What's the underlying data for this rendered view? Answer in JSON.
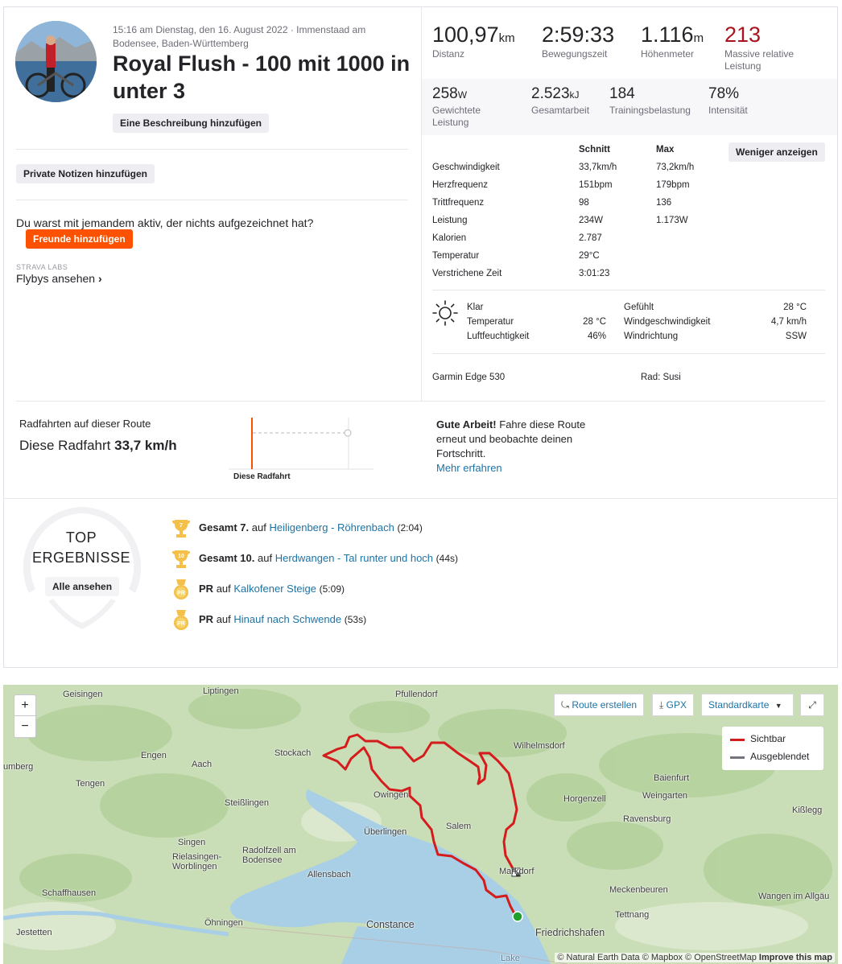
{
  "header": {
    "meta": "15:16 am Dienstag, den 16. August 2022 · Immenstaad am Bodensee, Baden-Württemberg",
    "title": "Royal Flush - 100 mit 1000 in unter 3",
    "add_description": "Eine Beschreibung hinzufügen"
  },
  "left": {
    "private_notes": "Private Notizen hinzufügen",
    "with_someone": "Du warst mit jemandem aktiv, der nichts aufgezeichnet hat?",
    "add_friends": "Freunde hinzufügen",
    "labs": "STRAVA LABS",
    "flybys": "Flybys ansehen",
    "flybys_arrow": "›"
  },
  "stats": {
    "distance": {
      "value": "100,97",
      "unit": "km",
      "label": "Distanz"
    },
    "moving_time": {
      "value": "2:59:33",
      "label": "Bewegungszeit"
    },
    "elevation": {
      "value": "1.116",
      "unit": "m",
      "label": "Höhenmeter"
    },
    "relative_effort": {
      "value": "213",
      "label": "Massive relative Leistung"
    },
    "weighted_power": {
      "value": "258",
      "unit": "W",
      "label": "Gewichtete Leistung"
    },
    "total_work": {
      "value": "2.523",
      "unit": "kJ",
      "label": "Gesamtarbeit"
    },
    "training_load": {
      "value": "184",
      "label": "Trainingsbelastung"
    },
    "intensity": {
      "value": "78%",
      "label": "Intensität"
    },
    "relative_effort_color": "#a8131f"
  },
  "detail": {
    "col_avg": "Schnitt",
    "col_max": "Max",
    "show_less": "Weniger anzeigen",
    "rows": [
      {
        "label": "Geschwindigkeit",
        "avg": "33,7km/h",
        "max": "73,2km/h"
      },
      {
        "label": "Herzfrequenz",
        "avg": "151bpm",
        "max": "179bpm"
      },
      {
        "label": "Trittfrequenz",
        "avg": "98",
        "max": "136"
      },
      {
        "label": "Leistung",
        "avg": "234W",
        "max": "1.173W"
      },
      {
        "label": "Kalorien",
        "avg": "2.787",
        "max": ""
      },
      {
        "label": "Temperatur",
        "avg": "29°C",
        "max": ""
      },
      {
        "label": "Verstrichene Zeit",
        "avg": "3:01:23",
        "max": ""
      }
    ]
  },
  "weather": {
    "icon": "sun-icon",
    "condition": "Klar",
    "temp_label": "Temperatur",
    "temp": "28 °C",
    "humidity_label": "Luftfeuchtigkeit",
    "humidity": "46%",
    "feels_label": "Gefühlt",
    "feels": "28 °C",
    "wind_speed_label": "Windgeschwindigkeit",
    "wind_speed": "4,7 km/h",
    "wind_dir_label": "Windrichtung",
    "wind_dir": "SSW"
  },
  "device": {
    "name": "Garmin Edge 530",
    "bike": "Rad: Susi"
  },
  "route": {
    "label": "Radfahrten auf dieser Route",
    "this_ride": "Diese Radfahrt",
    "speed": "33,7 km/h",
    "chart_label": "Diese Radfahrt",
    "msg_bold": "Gute Arbeit!",
    "msg": "Fahre diese Route erneut und beobachte deinen Fortschritt.",
    "more": "Mehr erfahren"
  },
  "top": {
    "title_1": "TOP",
    "title_2": "ERGEBNISSE",
    "see_all": "Alle ansehen",
    "items": [
      {
        "medal": "7",
        "rank": "Gesamt 7.",
        "prep": "auf",
        "segment": "Heiligenberg - Röhrenbach",
        "time": "(2:04)"
      },
      {
        "medal": "10",
        "rank": "Gesamt 10.",
        "prep": "auf",
        "segment": "Herdwangen - Tal runter und hoch",
        "time": "(44s)"
      },
      {
        "medal": "PR",
        "rank": "PR",
        "prep": "auf",
        "segment": "Kalkofener Steige",
        "time": "(5:09)"
      },
      {
        "medal": "PR",
        "rank": "PR",
        "prep": "auf",
        "segment": "Hinauf nach Schwende",
        "time": "(53s)"
      }
    ]
  },
  "map": {
    "zoom_in": "+",
    "zoom_out": "−",
    "create_route": "Route erstellen",
    "gpx": "GPX",
    "map_type": "Standardkarte",
    "legend_visible": "Sichtbar",
    "legend_hidden": "Ausgeblendet",
    "attribution": "© Natural Earth Data © Mapbox © OpenStreetMap",
    "improve": "Improve this map",
    "route_color": "#d41c1c",
    "places": [
      "Geisingen",
      "Liptingen",
      "Pfullendorf",
      "umberg",
      "Engen",
      "Aach",
      "Stockach",
      "Wilhelmsdorf",
      "Tengen",
      "Steißlingen",
      "Owingen",
      "Baienfurt",
      "Horgenzell",
      "Weingarten",
      "Kißlegg",
      "Singen",
      "Überlingen",
      "Salem",
      "Ravensburg",
      "Radolfzell am Bodensee",
      "Rielasingen-Worblingen",
      "Markdorf",
      "Allensbach",
      "Meckenbeuren",
      "Schaffhausen",
      "Wangen im Allgäu",
      "Tettnang",
      "Öhningen",
      "Constance",
      "Friedrichshafen",
      "Jestetten",
      "Lake"
    ]
  }
}
